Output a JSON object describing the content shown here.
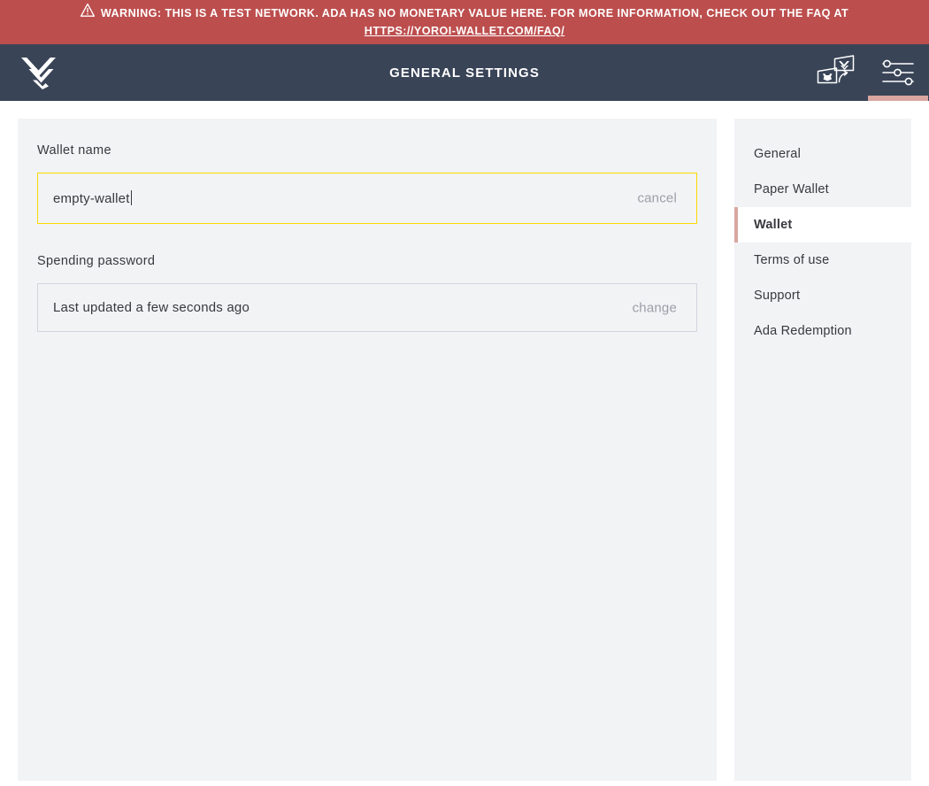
{
  "warning": {
    "icon": "warning-triangle-icon",
    "line1": "WARNING: THIS IS A TEST NETWORK. ADA HAS NO MONETARY VALUE HERE. FOR MORE INFORMATION, CHECK OUT THE FAQ AT",
    "link_text": "HTTPS://YOROI-WALLET.COM/FAQ/",
    "background": "#bd4e4e",
    "text_color": "#ffffff"
  },
  "navbar": {
    "logo_name": "yoroi-logo",
    "title": "GENERAL SETTINGS",
    "background": "#394457",
    "actions": [
      {
        "name": "wallet-switch-icon",
        "label": "Switch wallet",
        "active": false
      },
      {
        "name": "settings-sliders-icon",
        "label": "Settings",
        "active": true
      }
    ],
    "active_indicator_color": "#d9a7a0"
  },
  "settings": {
    "wallet_name": {
      "label": "Wallet name",
      "value": "empty-wallet",
      "placeholder": "Wallet name",
      "action_label": "cancel",
      "focused": true,
      "focus_border_color": "#fada00"
    },
    "spending_password": {
      "label": "Spending password",
      "status_text": "Last updated a few seconds ago",
      "action_label": "change",
      "border_color": "#d2d5dd"
    },
    "panel_background": "#f1f3f5"
  },
  "menu": {
    "items": [
      {
        "label": "General",
        "active": false
      },
      {
        "label": "Paper Wallet",
        "active": false
      },
      {
        "label": "Wallet",
        "active": true
      },
      {
        "label": "Terms of use",
        "active": false
      },
      {
        "label": "Support",
        "active": false
      },
      {
        "label": "Ada Redemption",
        "active": false
      }
    ],
    "active_accent_color": "#d9a7a0"
  }
}
